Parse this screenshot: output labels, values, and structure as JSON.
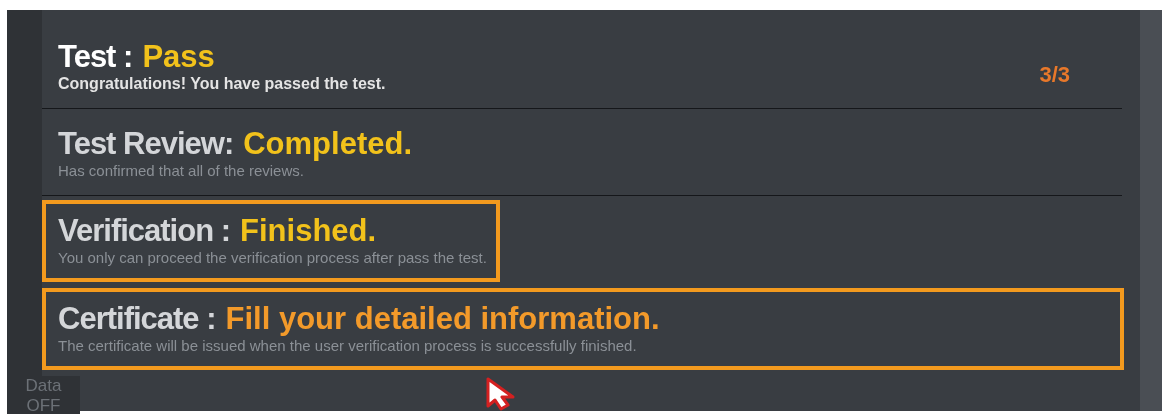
{
  "progress": "3/3",
  "rows": [
    {
      "kind": "result",
      "label": "Test :",
      "status": "Pass",
      "color": "#f2c21b",
      "description": "Congratulations! You have passed the test.",
      "highlighted": false
    },
    {
      "kind": "step",
      "label": "Test Review:",
      "status": "Completed.",
      "color": "#f2c21b",
      "description": "Has confirmed that all of the reviews.",
      "highlighted": false
    },
    {
      "kind": "check",
      "label": "Verification :",
      "status": "Finished.",
      "color": "#f2c21b",
      "description": "You only can proceed the verification process after pass the test.",
      "highlighted": true
    },
    {
      "kind": "goal",
      "label": "Certificate :",
      "status": "Fill your detailed information.",
      "color": "#f39a2a",
      "description": "The certificate will be issued when the user verification process is successfully finished.",
      "highlighted": true
    }
  ],
  "sidebar_item": {
    "label": "Data",
    "value": "OFF"
  }
}
